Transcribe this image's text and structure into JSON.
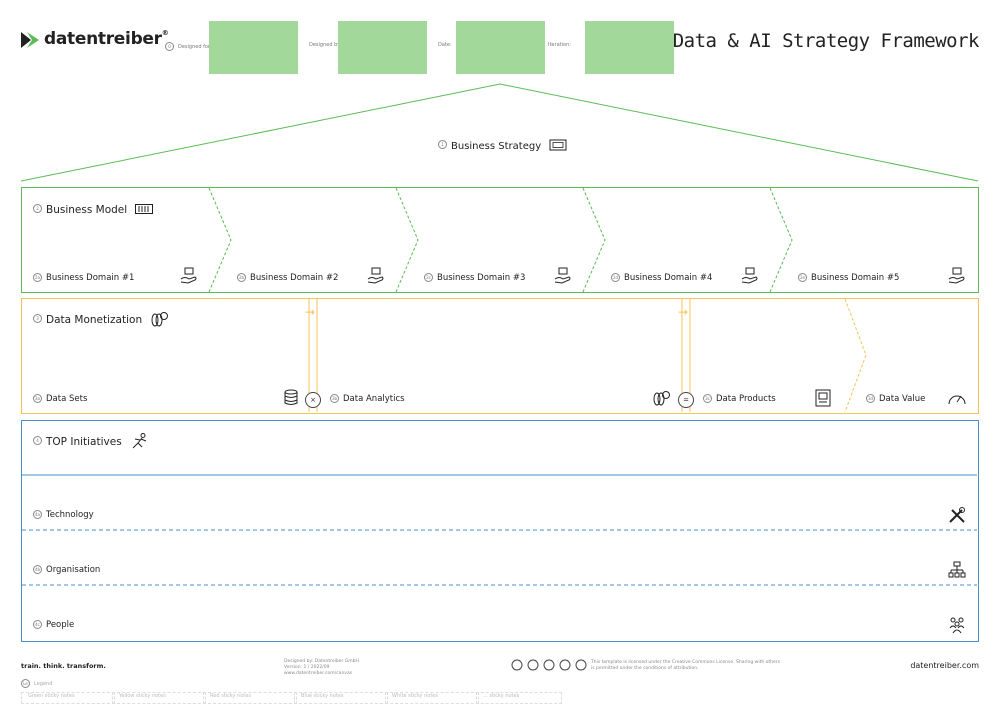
{
  "header": {
    "logo_text": "datentreiber",
    "logo_mark": "®",
    "fields": [
      {
        "num": "0",
        "label": "Designed for:"
      },
      {
        "num": "",
        "label": "Designed by:"
      },
      {
        "num": "",
        "label": "Date:"
      },
      {
        "num": "",
        "label": "Iteration:"
      }
    ],
    "title": "Data & AI Strategy Framework"
  },
  "business_strategy": {
    "num": "1",
    "label": "Business Strategy",
    "icon": "presentation-board-icon"
  },
  "business_model": {
    "num": "2",
    "title": "Business Model",
    "icon": "barcode-icon",
    "domains": [
      {
        "num": "2a",
        "label": "Business Domain #1"
      },
      {
        "num": "2b",
        "label": "Business Domain #2"
      },
      {
        "num": "2c",
        "label": "Business Domain #3"
      },
      {
        "num": "2d",
        "label": "Business Domain #4"
      },
      {
        "num": "2e",
        "label": "Business Domain #5"
      }
    ]
  },
  "data_monetization": {
    "num": "3",
    "title": "Data Monetization",
    "icon": "coins-icon",
    "cells": [
      {
        "num": "3a",
        "label": "Data Sets",
        "icon": "database-icon"
      },
      {
        "num": "3b",
        "label": "Data Analytics",
        "icon": "coins-icon"
      },
      {
        "num": "3c",
        "label": "Data Products",
        "icon": "product-box-icon"
      },
      {
        "num": "3d",
        "label": "Data Value",
        "icon": "gauge-icon"
      }
    ],
    "op_multiply": "×",
    "op_equals": "=",
    "arrow": "→"
  },
  "top_initiatives": {
    "num": "4",
    "title": "TOP Initiatives",
    "icon": "runner-icon",
    "rows": [
      {
        "num": "4a",
        "label": "Technology",
        "icon": "tools-icon"
      },
      {
        "num": "4b",
        "label": "Organisation",
        "icon": "org-chart-icon"
      },
      {
        "num": "4c",
        "label": "People",
        "icon": "people-icon"
      }
    ]
  },
  "footer": {
    "tagline": "train. think. transform.",
    "credits_1": "Designed by: Datentreiber GmbH",
    "credits_2": "Version: 1 / 2022/09",
    "credits_3": "www.datentreiber.com/canvas",
    "license_text": "This template is licensed under the Creative Commons License. Sharing with others is permitted under the conditions of attribution.",
    "website": "datentreiber.com",
    "legend_num": "Le",
    "legend_label": "Legend",
    "stickies": [
      "Green sticky notes",
      "Yellow sticky notes",
      "Red sticky notes",
      "Blue sticky notes",
      "White sticky notes",
      "... sticky notes"
    ]
  },
  "colors": {
    "green": "#5cbb55",
    "yellow": "#f4c25a",
    "blue": "#4a8fd0",
    "green_fill": "#a2d89a"
  }
}
